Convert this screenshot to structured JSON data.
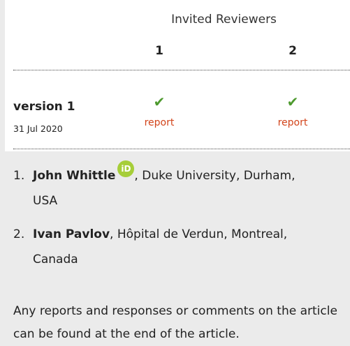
{
  "header": {
    "title": "Invited Reviewers",
    "columns": [
      "1",
      "2"
    ]
  },
  "version": {
    "label": "version 1",
    "date": "31 Jul 2020",
    "reports": [
      {
        "status_icon": "check-icon",
        "link_text": "report"
      },
      {
        "status_icon": "check-icon",
        "link_text": "report"
      }
    ]
  },
  "reviewers": [
    {
      "index": "1.",
      "name": "John Whittle",
      "has_orcid": true,
      "orcid_label": "iD",
      "affiliation_line1": ", Duke University, Durham,",
      "affiliation_line2": "USA"
    },
    {
      "index": "2.",
      "name": "Ivan Pavlov",
      "affiliation_line1": ", Hôpital de Verdun, Montreal,",
      "affiliation_line2": "Canada"
    }
  ],
  "footer": {
    "note": "Any reports and responses or comments on the article can be found at the end of the article."
  },
  "colors": {
    "check": "#4e9a2f",
    "report_link": "#d2441a",
    "orcid": "#a6ce39",
    "panel_bg": "#ebebeb"
  }
}
